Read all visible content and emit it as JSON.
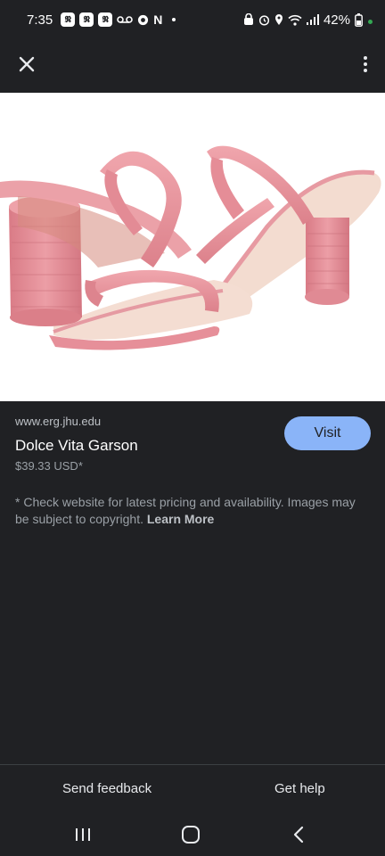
{
  "status_bar": {
    "time": "7:35",
    "battery": "42%",
    "left_icons": [
      "nytimes-icon",
      "nytimes-icon",
      "nytimes-icon",
      "voicemail-icon",
      "chrome-icon",
      "netflix-icon"
    ],
    "right_icons": [
      "lock-icon",
      "alarm-icon",
      "location-icon",
      "wifi-icon",
      "signal-icon",
      "battery-icon"
    ]
  },
  "top_bar": {
    "close_icon": "close-icon",
    "more_icon": "more-vert-icon"
  },
  "product": {
    "source": "www.erg.jhu.edu",
    "title": "Dolce Vita Garson",
    "price": "$39.33 USD*",
    "visit_label": "Visit",
    "image_description": "pink-strappy-block-heel-sandals"
  },
  "disclaimer": {
    "text": "* Check website for latest pricing and availability. Images may be subject to copyright.",
    "learn_more": "Learn More"
  },
  "footer": {
    "send_feedback": "Send feedback",
    "get_help": "Get help"
  },
  "nav": {
    "recents_icon": "recents-icon",
    "home_icon": "home-icon",
    "back_icon": "back-icon"
  },
  "colors": {
    "background": "#202124",
    "accent": "#8ab4f8",
    "battery": "#34a853",
    "product": "#e8939b"
  }
}
